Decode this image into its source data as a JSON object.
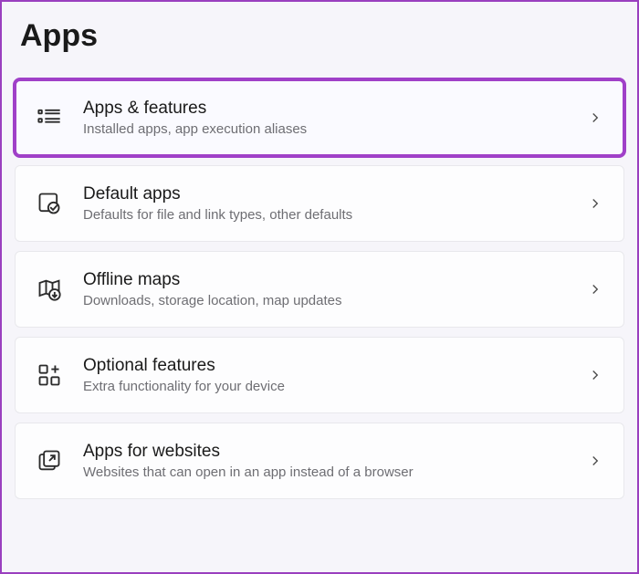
{
  "page": {
    "title": "Apps"
  },
  "items": [
    {
      "icon": "apps-features",
      "title": "Apps & features",
      "desc": "Installed apps, app execution aliases",
      "highlighted": true
    },
    {
      "icon": "default-apps",
      "title": "Default apps",
      "desc": "Defaults for file and link types, other defaults",
      "highlighted": false
    },
    {
      "icon": "offline-maps",
      "title": "Offline maps",
      "desc": "Downloads, storage location, map updates",
      "highlighted": false
    },
    {
      "icon": "optional-features",
      "title": "Optional features",
      "desc": "Extra functionality for your device",
      "highlighted": false
    },
    {
      "icon": "apps-websites",
      "title": "Apps for websites",
      "desc": "Websites that can open in an app instead of a browser",
      "highlighted": false
    }
  ]
}
